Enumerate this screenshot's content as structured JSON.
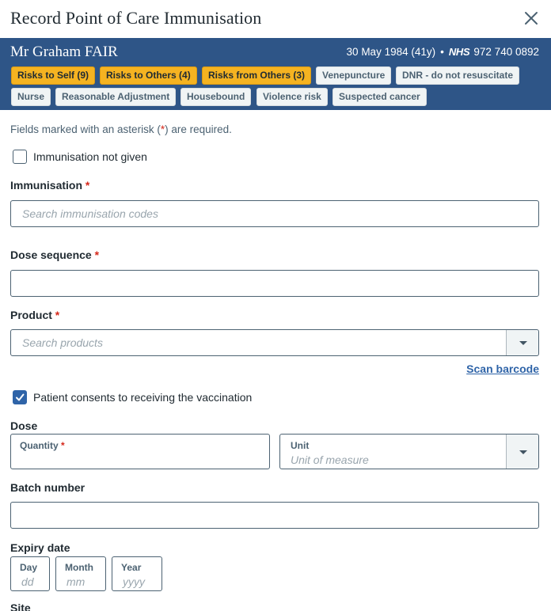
{
  "dialog": {
    "title": "Record Point of Care Immunisation",
    "close_icon": "close-icon"
  },
  "patient": {
    "name": "Mr Graham FAIR",
    "dob": "30 May 1984 (41y)",
    "separator": "•",
    "nhs_label": "NHS",
    "nhs_number": "972 740 0892",
    "alerts": [
      "Risks to Self (9)",
      "Risks to Others (4)",
      "Risks from Others (3)",
      "Venepuncture",
      "DNR - do not resuscitate",
      "Nurse",
      "Reasonable Adjustment",
      "Housebound",
      "Violence risk",
      "Suspected cancer"
    ],
    "colors": {
      "banner": "#2e5587",
      "alert_amber": "#f5b321",
      "alert_grey": "#f0f4f5"
    }
  },
  "form": {
    "hint_prefix": "Fields marked with an asterisk (",
    "hint_star": "*",
    "hint_suffix": ") are required.",
    "required_star": "*",
    "not_given": {
      "label": "Immunisation not given",
      "checked": false
    },
    "immunisation": {
      "label": "Immunisation",
      "placeholder": "Search immunisation codes",
      "value": ""
    },
    "dose_sequence": {
      "label": "Dose sequence",
      "value": ""
    },
    "product": {
      "label": "Product",
      "placeholder": "Search products",
      "value": ""
    },
    "scan_barcode": "Scan barcode",
    "consent": {
      "label": "Patient consents to receiving the vaccination",
      "checked": true
    },
    "dose": {
      "label": "Dose",
      "quantity_label": "Quantity",
      "quantity_value": "",
      "unit_label": "Unit",
      "unit_placeholder": "Unit of measure"
    },
    "batch": {
      "label": "Batch number",
      "value": ""
    },
    "expiry": {
      "label": "Expiry date",
      "day_label": "Day",
      "day_placeholder": "dd",
      "month_label": "Month",
      "month_placeholder": "mm",
      "year_label": "Year",
      "year_placeholder": "yyyy"
    },
    "site": {
      "label": "Site"
    }
  }
}
